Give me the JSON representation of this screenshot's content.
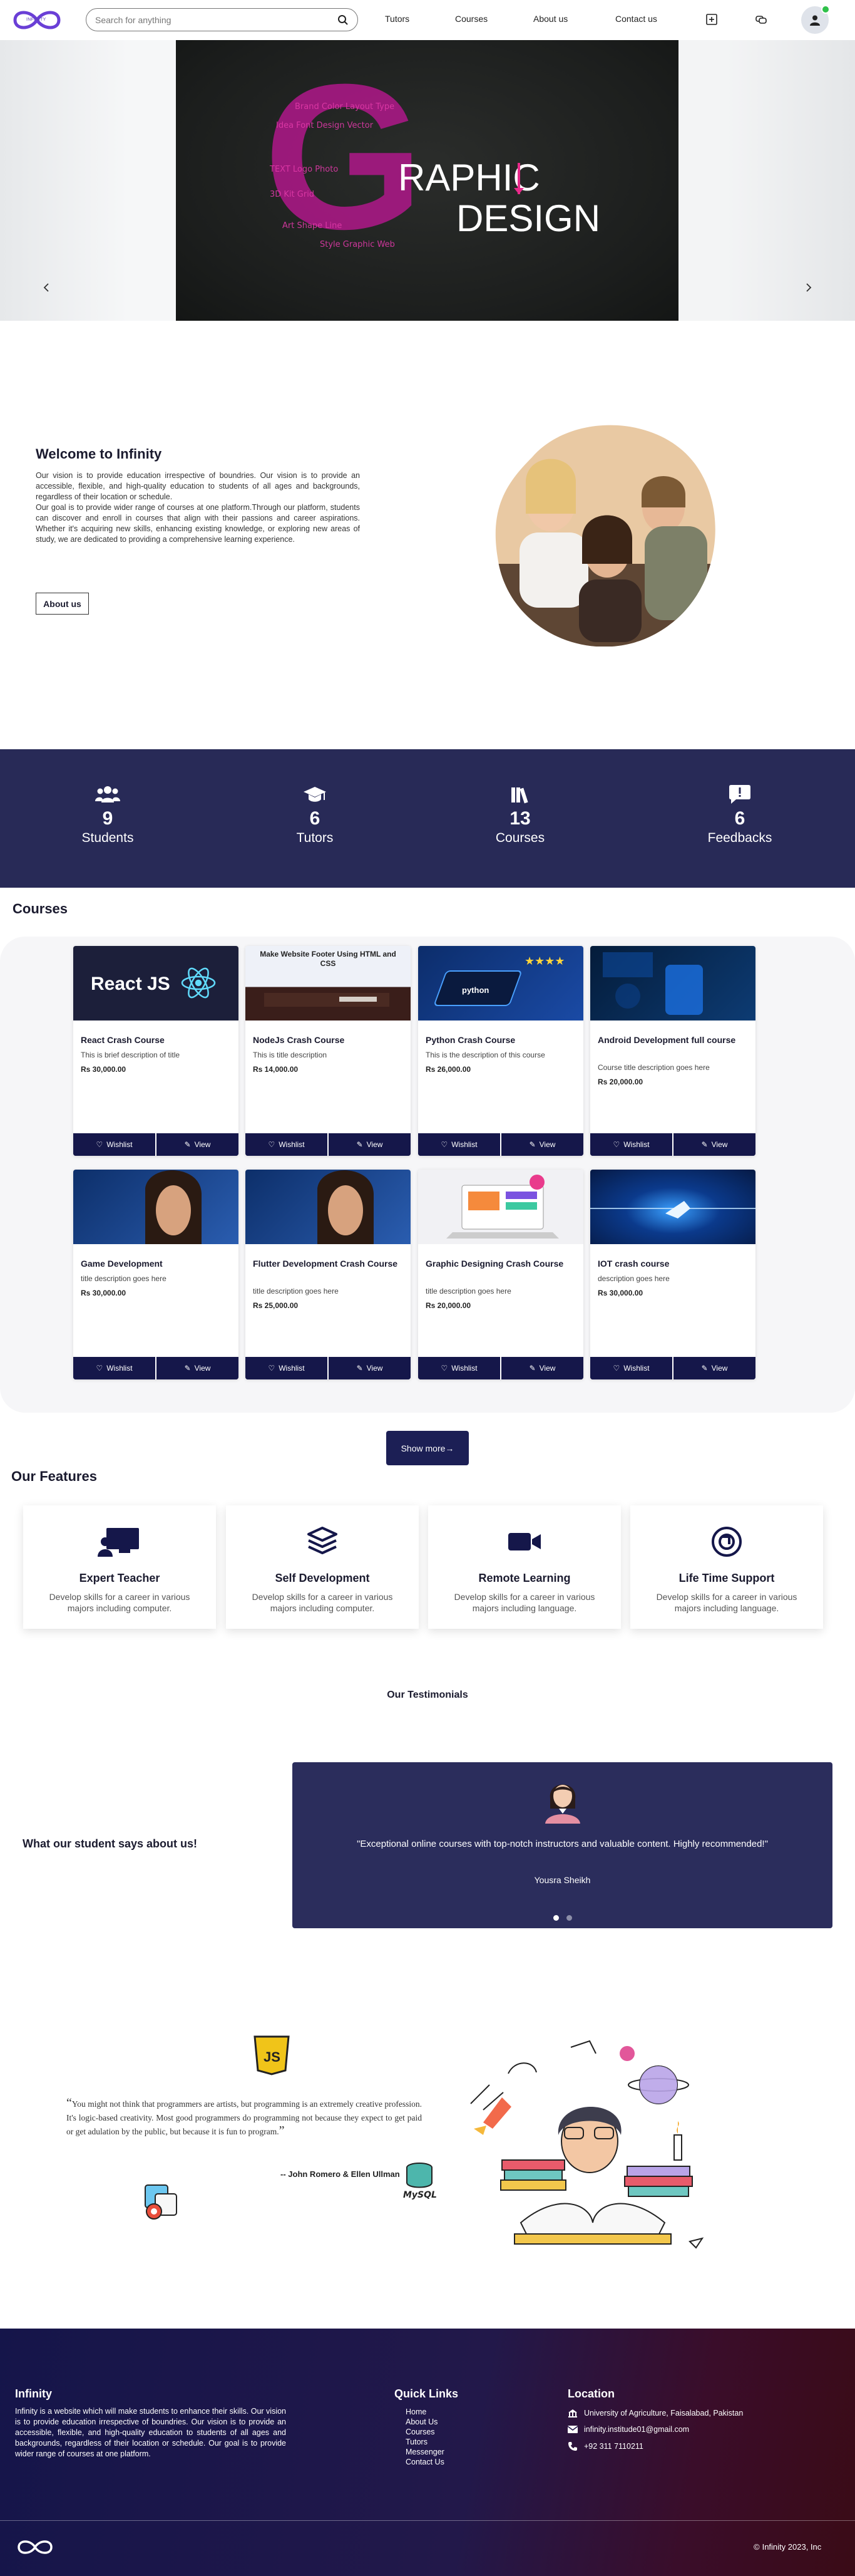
{
  "header": {
    "logo_text": "INFINITY",
    "search_placeholder": "Search for anything",
    "nav": [
      "Tutors",
      "Courses",
      "About us",
      "Contact us"
    ]
  },
  "hero": {
    "banner_word1": "RAPHIC",
    "banner_word2": "DESIGN",
    "banner_letter": "G"
  },
  "welcome": {
    "title": "Welcome to Infinity",
    "p1": "Our vision is to provide education irrespective of boundries. Our vision is to provide an accessible, flexible, and high-quality education to students of all ages and backgrounds, regardless of their location or schedule.",
    "p2": "Our goal is to provide wider range of courses at one platform.Through our platform, students can discover and enroll in courses that align with their passions and career aspirations. Whether it's acquiring new skills, enhancing existing knowledge, or exploring new areas of study, we are dedicated to providing a comprehensive learning experience.",
    "button": "About us"
  },
  "stats": [
    {
      "value": "9",
      "label": "Students",
      "icon": "users-icon"
    },
    {
      "value": "6",
      "label": "Tutors",
      "icon": "graduation-cap-icon"
    },
    {
      "value": "13",
      "label": "Courses",
      "icon": "books-icon"
    },
    {
      "value": "6",
      "label": "Feedbacks",
      "icon": "feedback-icon"
    }
  ],
  "courses": {
    "title": "Courses",
    "items": [
      {
        "title": "React Crash Course",
        "desc": "This is brief description of title",
        "price": "Rs 30,000.00",
        "thumb": "React JS"
      },
      {
        "title": "NodeJs Crash Course",
        "desc": "This is title description",
        "price": "Rs 14,000.00",
        "thumb": "Make Website Footer Using HTML and CSS"
      },
      {
        "title": "Python Crash Course",
        "desc": "This is the description of this course",
        "price": "Rs 26,000.00",
        "thumb": "python"
      },
      {
        "title": "Android Development full course",
        "desc": "Course title description goes here",
        "price": "Rs 20,000.00",
        "thumb": ""
      },
      {
        "title": "Game Development",
        "desc": "title description goes here",
        "price": "Rs 30,000.00",
        "thumb": ""
      },
      {
        "title": "Flutter Development Crash Course",
        "desc": "title description goes here",
        "price": "Rs 25,000.00",
        "thumb": ""
      },
      {
        "title": "Graphic Designing Crash Course",
        "desc": "title description goes here",
        "price": "Rs 20,000.00",
        "thumb": ""
      },
      {
        "title": "IOT crash course",
        "desc": "description goes here",
        "price": "Rs 30,000.00",
        "thumb": ""
      }
    ],
    "wishlist_label": "Wishlist",
    "view_label": "View",
    "show_more": "Show more→"
  },
  "features": {
    "title": "Our Features",
    "items": [
      {
        "title": "Expert Teacher",
        "desc": "Develop skills for a career in various majors including computer.",
        "icon": "teacher-icon"
      },
      {
        "title": "Self Development",
        "desc": "Develop skills for a career in various majors including computer.",
        "icon": "layers-icon"
      },
      {
        "title": "Remote Learning",
        "desc": "Develop skills for a career in various majors including language.",
        "icon": "video-camera-icon"
      },
      {
        "title": "Life Time Support",
        "desc": "Develop skills for a career in various majors including language.",
        "icon": "support-icon"
      }
    ]
  },
  "testimonials": {
    "heading": "Our Testimonials",
    "side_title": "What our student says about us!",
    "quote": "\"Exceptional online courses with top-notch instructors and valuable content. Highly recommended!\"",
    "name": "Yousra Sheikh"
  },
  "quote_section": {
    "text": "You might not think that programmers are artists, but programming is an extremely creative profession. It's logic-based creativity. Most good programmers do programming not because they expect to get paid or get adulation by the public, but because it is fun to program.",
    "author": "-- John Romero & Ellen Ullman",
    "js_badge": "JS",
    "mysql_label": "MySQL"
  },
  "footer": {
    "brand": "Infinity",
    "about": "Infinity is a website which will make students to enhance their skills. Our vision is to provide education irrespective of boundries. Our vision is to provide an accessible, flexible, and high-quality education to students of all ages and backgrounds, regardless of their location or schedule. Our goal is to provide wider range of courses at one platform.",
    "links_title": "Quick Links",
    "links": [
      "Home",
      "About Us",
      "Courses",
      "Tutors",
      "Messenger",
      "Contact Us"
    ],
    "location_title": "Location",
    "address": "University of Agriculture, Faisalabad, Pakistan",
    "email": "infinity.institude01@gmail.com",
    "phone": "+92 311 7110211",
    "copyright": "Infinity 2023, Inc"
  },
  "colors": {
    "navy": "#282a57",
    "button_dark": "#15174a",
    "online": "#2fc14a",
    "accent_purple": "#6a3fd6"
  }
}
